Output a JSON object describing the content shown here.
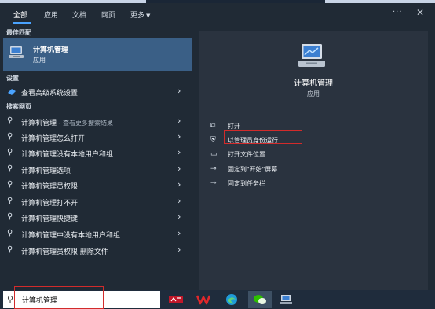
{
  "tabs": [
    "全部",
    "应用",
    "文档",
    "网页",
    "更多"
  ],
  "top_controls": {
    "more": "···",
    "close": "✕"
  },
  "sections": {
    "best_match": "最佳匹配",
    "settings": "设置",
    "search_web": "搜索网页"
  },
  "best_match": {
    "title": "计算机管理",
    "subtitle": "应用"
  },
  "settings_items": [
    {
      "label": "查看高级系统设置"
    }
  ],
  "web_items": [
    {
      "label": "计算机管理",
      "sub": " - 查看更多搜索结果"
    },
    {
      "label": "计算机管理怎么打开",
      "sub": ""
    },
    {
      "label": "计算机管理没有本地用户和组",
      "sub": ""
    },
    {
      "label": "计算机管理选项",
      "sub": ""
    },
    {
      "label": "计算机管理员权限",
      "sub": ""
    },
    {
      "label": "计算机管理打不开",
      "sub": ""
    },
    {
      "label": "计算机管理快捷键",
      "sub": ""
    },
    {
      "label": "计算机管理中没有本地用户和组",
      "sub": ""
    },
    {
      "label": "计算机管理员权限 删除文件",
      "sub": ""
    }
  ],
  "detail": {
    "title": "计算机管理",
    "subtitle": "应用",
    "actions": [
      {
        "label": "打开",
        "icon": "open-icon"
      },
      {
        "label": "以管理员身份运行",
        "icon": "shield-icon"
      },
      {
        "label": "打开文件位置",
        "icon": "folder-icon"
      },
      {
        "label": "固定到\"开始\"屏幕",
        "icon": "pin-icon"
      },
      {
        "label": "固定到任务栏",
        "icon": "pin-icon"
      }
    ]
  },
  "search": {
    "value": "计算机管理"
  },
  "taskbar_apps": [
    "bcp-app",
    "wps-app",
    "edge-app",
    "wechat-app",
    "network-app"
  ],
  "colors": {
    "panel": "#202a35",
    "detail": "#2a333f",
    "selected": "#3a5f86",
    "highlight": "#d22b2b",
    "accent": "#4aa3ff"
  }
}
